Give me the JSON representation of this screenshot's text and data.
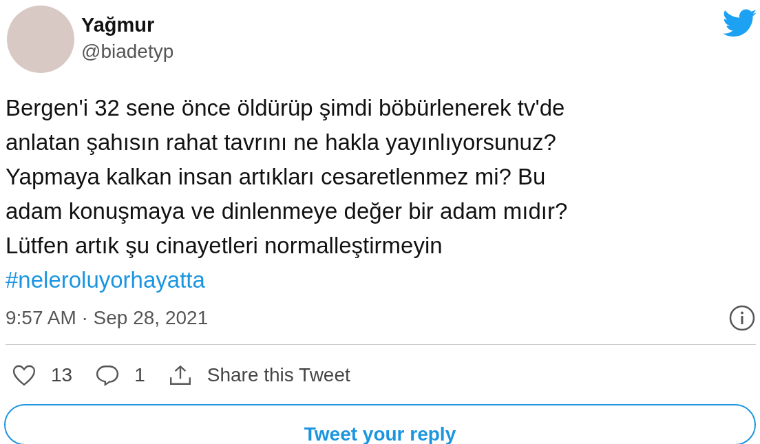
{
  "author": {
    "name": "Yağmur",
    "handle": "@biadetyp"
  },
  "tweet": {
    "text": "Bergen'i 32 sene önce öldürüp şimdi böbürlenerek tv'de\nanlatan şahısın rahat tavrını ne hakla yayınlıyorsunuz?\nYapmaya kalkan insan artıkları cesaretlenmez mi? Bu\nadam konuşmaya ve dinlenmeye değer bir adam mıdır?\nLütfen artık şu cinayetleri normalleştirmeyin",
    "hashtag": "#neleroluyorhayatta",
    "timestamp": "9:57 AM · Sep 28, 2021"
  },
  "actions": [
    {
      "kind": "like",
      "count": "13"
    },
    {
      "kind": "reply",
      "count": "1"
    },
    {
      "kind": "share",
      "label": "Share this Tweet"
    }
  ],
  "reply_button": "Tweet your reply"
}
